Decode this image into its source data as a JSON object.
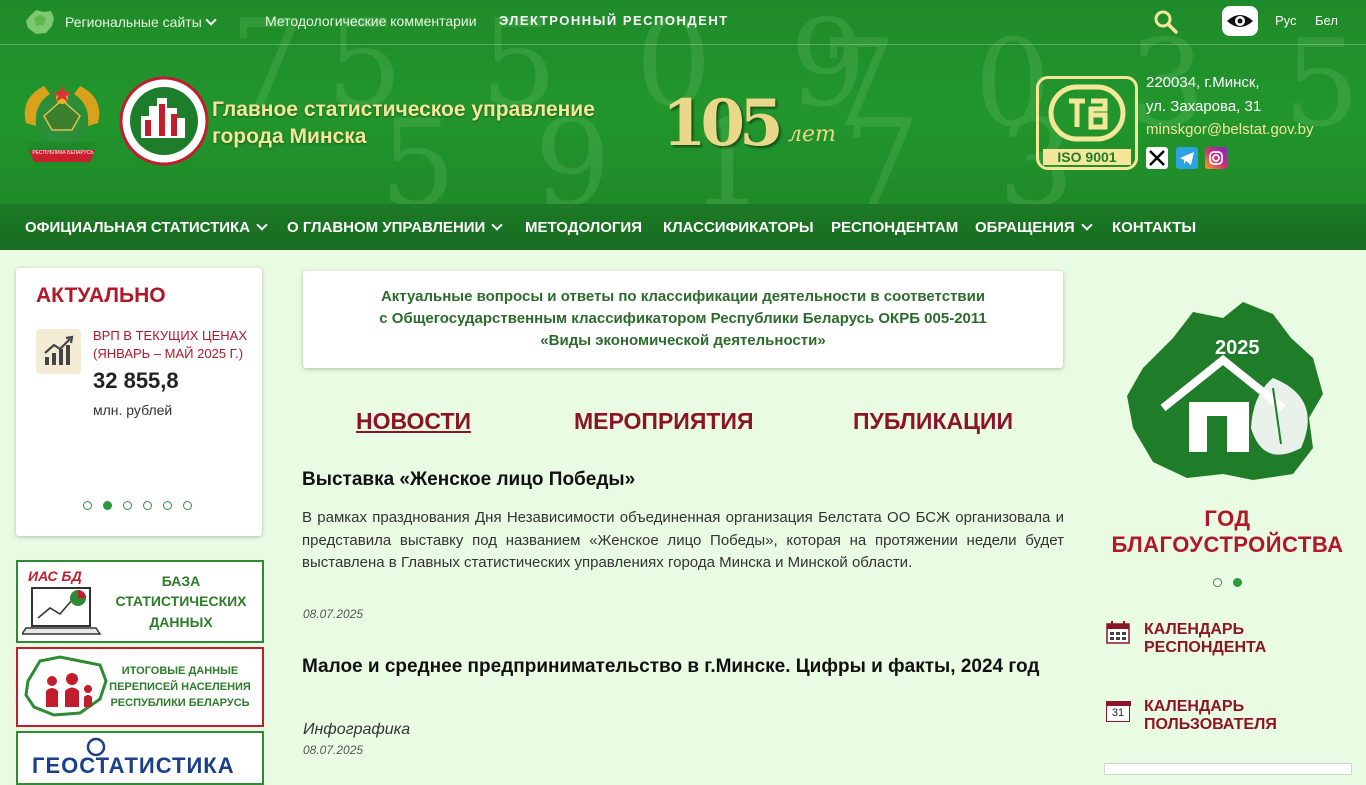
{
  "topbar": {
    "regional": "Региональные сайты",
    "method_comments": "Методологические комментарии",
    "e_respondent": "ЭЛЕКТРОННЫЙ РЕСПОНДЕНТ",
    "lang_ru": "Рус",
    "lang_by": "Бел"
  },
  "header": {
    "title_line1": "Главное статистическое управление",
    "title_line2": "города Минска",
    "anniv_number": "105",
    "anniv_word": "лет",
    "iso": "ISO 9001",
    "address_line1": "220034, г.Минск,",
    "address_line2": "ул. Захарова, 31",
    "email": "minskgor@belstat.gov.by",
    "emblem_ribbon": "РЕСПУБЛИКА БЕЛАРУСЬ"
  },
  "nav": {
    "items": [
      "ОФИЦИАЛЬНАЯ СТАТИСТИКА",
      "О ГЛАВНОМ УПРАВЛЕНИИ",
      "МЕТОДОЛОГИЯ",
      "КЛАССИФИКАТОРЫ",
      "РЕСПОНДЕНТАМ",
      "ОБРАЩЕНИЯ",
      "КОНТАКТЫ"
    ]
  },
  "aktual": {
    "title": "АКТУАЛЬНО",
    "label_line1": "ВРП В ТЕКУЩИХ ЦЕНАХ",
    "label_line2": "(ЯНВАРЬ – МАЙ 2025 Г.)",
    "value": "32 855,8",
    "unit": "млн. рублей",
    "slides": 6,
    "active_slide": 2
  },
  "banners": {
    "ias_tag": "ИАС БД",
    "db_line1": "БАЗА",
    "db_line2": "СТАТИСТИЧЕСКИХ",
    "db_line3": "ДАННЫХ",
    "census_line1": "ИТОГОВЫЕ ДАННЫЕ",
    "census_line2": "ПЕРЕПИСЕЙ НАСЕЛЕНИЯ",
    "census_line3": "РЕСПУБЛИКИ БЕЛАРУСЬ",
    "geo": "ГЕОСТАТИСТИКА"
  },
  "notice": {
    "line1": "Актуальные вопросы и ответы по классификации деятельности в соответствии",
    "line2": "с Общегосударственным классификатором Республики Беларусь ОКРБ 005-2011",
    "line3": "«Виды экономической деятельности»"
  },
  "tabs": [
    "НОВОСТИ",
    "МЕРОПРИЯТИЯ",
    "ПУБЛИКАЦИИ"
  ],
  "news": [
    {
      "title": "Выставка «Женское лицо Победы»",
      "body": "В рамках празднования Дня Независимости объединенная организация Белстата ОО БСЖ организовала и представила выставку под названием «Женское лицо Победы», которая на протяжении недели будет выставлена в Главных статистических управлениях города Минска и Минской области.",
      "date": "08.07.2025"
    },
    {
      "title": "Малое и среднее предпринимательство в г.Минске. Цифры и факты, 2024 год",
      "subtitle": "Инфографика",
      "date": "08.07.2025"
    }
  ],
  "right": {
    "year_badge": "2025",
    "year_caption": "ГОД БЛАГОУСТРОЙСТВА",
    "slides": 2,
    "active_slide": 2,
    "cal1_line1": "КАЛЕНДАРЬ",
    "cal1_line2": "РЕСПОНДЕНТА",
    "cal2_line1": "КАЛЕНДАРЬ",
    "cal2_line2": "ПОЛЬЗОВАТЕЛЯ",
    "cal2_day": "31"
  },
  "colors": {
    "header_green": "#22962c",
    "nav_green": "#1b7724",
    "accent_red": "#b0182a",
    "title_gold": "#f5e79a",
    "page_bg": "#eafbe3"
  }
}
